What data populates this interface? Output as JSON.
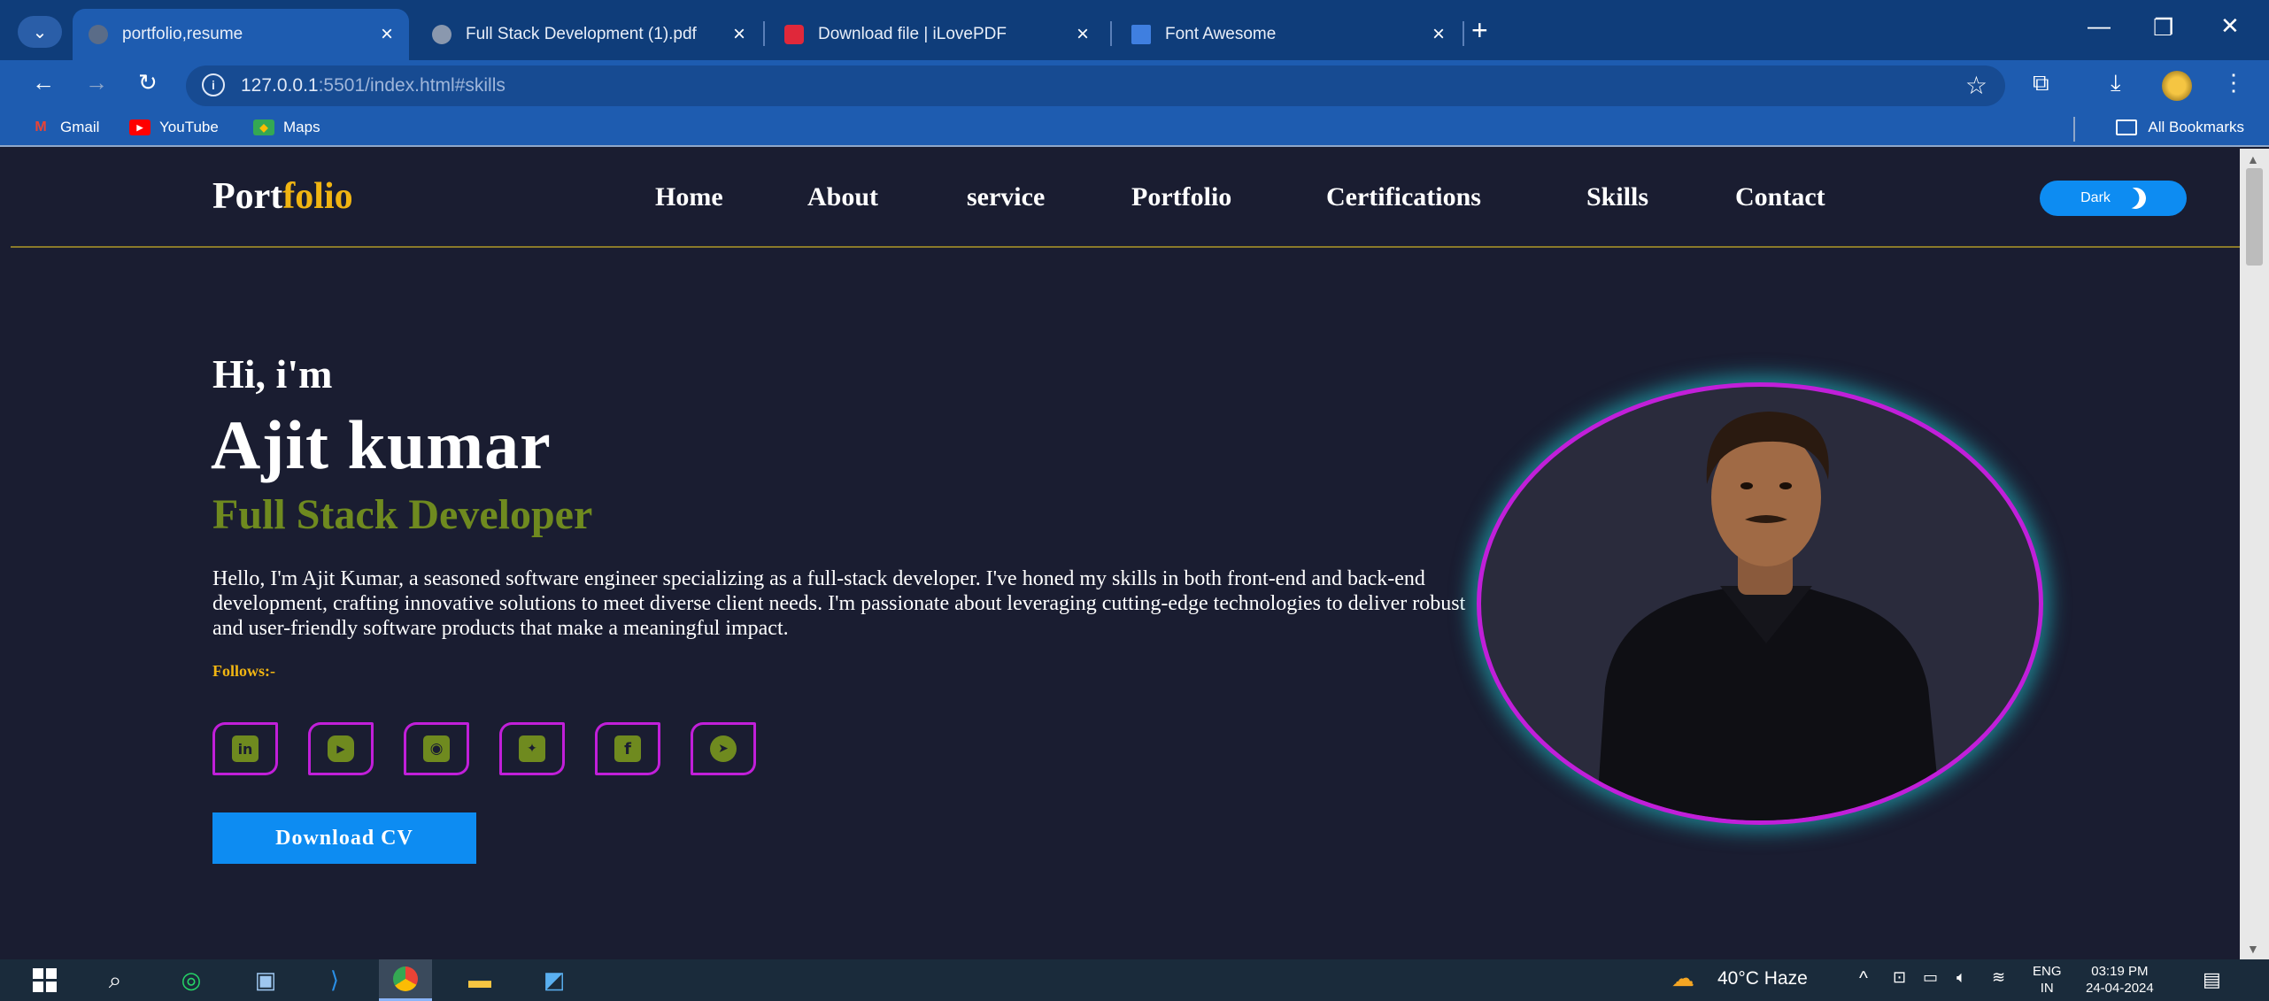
{
  "browser": {
    "tabs": [
      {
        "title": "portfolio,resume",
        "close": "×",
        "active": true
      },
      {
        "title": "Full Stack Development (1).pdf",
        "close": "×",
        "active": false
      },
      {
        "title": "Download file | iLovePDF",
        "close": "×",
        "active": false
      },
      {
        "title": "Font Awesome",
        "close": "×",
        "active": false
      }
    ],
    "new_tab": "+",
    "url_host": "127.0.0.1",
    "url_rest": ":5501/index.html#skills",
    "bookmarks": [
      {
        "label": "Gmail",
        "icon": "gmail-icon"
      },
      {
        "label": "YouTube",
        "icon": "youtube-icon"
      },
      {
        "label": "Maps",
        "icon": "maps-icon"
      }
    ],
    "all_bookmarks": "All Bookmarks"
  },
  "site": {
    "logo_main": "Port",
    "logo_accent": "folio",
    "nav": [
      "Home",
      "About",
      "service",
      "Portfolio",
      "Certifications",
      "Skills",
      "Contact"
    ],
    "dark_toggle": "Dark",
    "greeting": "Hi, i'm",
    "name": "Ajit kumar",
    "role": "Full Stack Developer",
    "bio": "Hello, I'm Ajit Kumar, a seasoned software engineer specializing as a full-stack developer. I've honed my skills in both front-end and back-end development, crafting innovative solutions to meet diverse client needs. I'm passionate about leveraging cutting-edge technologies to deliver robust and user-friendly software products that make a meaningful impact.",
    "follows_label": "Follows:-",
    "socials": [
      "linkedin-icon",
      "youtube-icon",
      "github-icon",
      "twitter-icon",
      "facebook-icon",
      "telegram-icon"
    ],
    "cv_button": "Download CV",
    "colors": {
      "accent_yellow": "#f1b512",
      "role_green": "#6f8a1f",
      "button_blue": "#0d8cf2",
      "social_border": "#c11fd9",
      "page_bg": "#1a1d31"
    }
  },
  "taskbar": {
    "weather": "40°C  Haze",
    "lang_top": "ENG",
    "lang_bottom": "IN",
    "time": "03:19 PM",
    "date": "24-04-2024"
  }
}
